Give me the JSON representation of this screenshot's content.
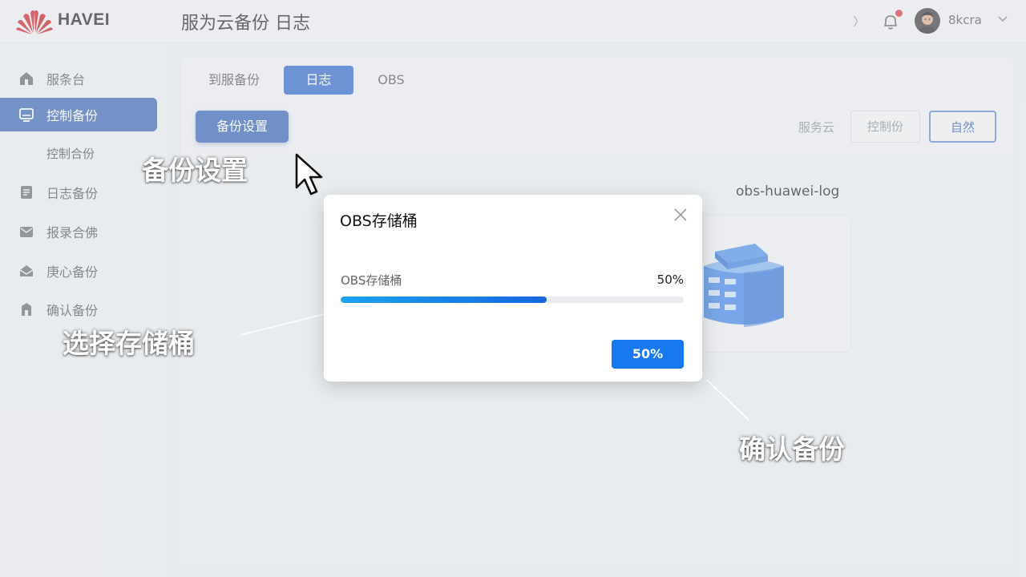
{
  "header": {
    "brand": "HAVEI",
    "title": "服为云备份  日志",
    "nav_chevron": "〉",
    "username": "8kcra"
  },
  "sidebar": {
    "items": [
      {
        "label": "服条台",
        "icon": "home-icon"
      },
      {
        "label": "控制备份",
        "icon": "monitor-icon",
        "active": true
      },
      {
        "label": "控制合份",
        "sub": true
      },
      {
        "label": "日志备份",
        "icon": "document-icon"
      },
      {
        "label": "报录合佛",
        "icon": "mail-icon"
      },
      {
        "label": "庚心备份",
        "icon": "envelope-open-icon"
      },
      {
        "label": "确认备份",
        "icon": "building-icon"
      }
    ]
  },
  "main": {
    "tabs": [
      {
        "label": "到服备份"
      },
      {
        "label": "日志",
        "active": true
      },
      {
        "label": "OBS"
      }
    ],
    "backup_settings_button": "备份设置",
    "right_label": "服务云",
    "control_button": "控制份",
    "natural_button": "自然",
    "bucket_name": "obs-huawei-log"
  },
  "modal": {
    "title": "OBS存储桶",
    "progress_label": "OBS存储桶",
    "progress_text": "50%",
    "progress_fill_fraction": 0.6,
    "confirm_button": "50%"
  },
  "annotations": {
    "backup_settings": "备份设置",
    "select_bucket": "选择存储桶",
    "confirm_backup": "确认备份"
  },
  "colors": {
    "accent": "#2f66c9",
    "sidebar_active": "#3a64b4",
    "primary_button": "#1679f0",
    "progress_start": "#1aa3f0",
    "progress_end": "#1766e0",
    "notification": "#d8343a"
  }
}
